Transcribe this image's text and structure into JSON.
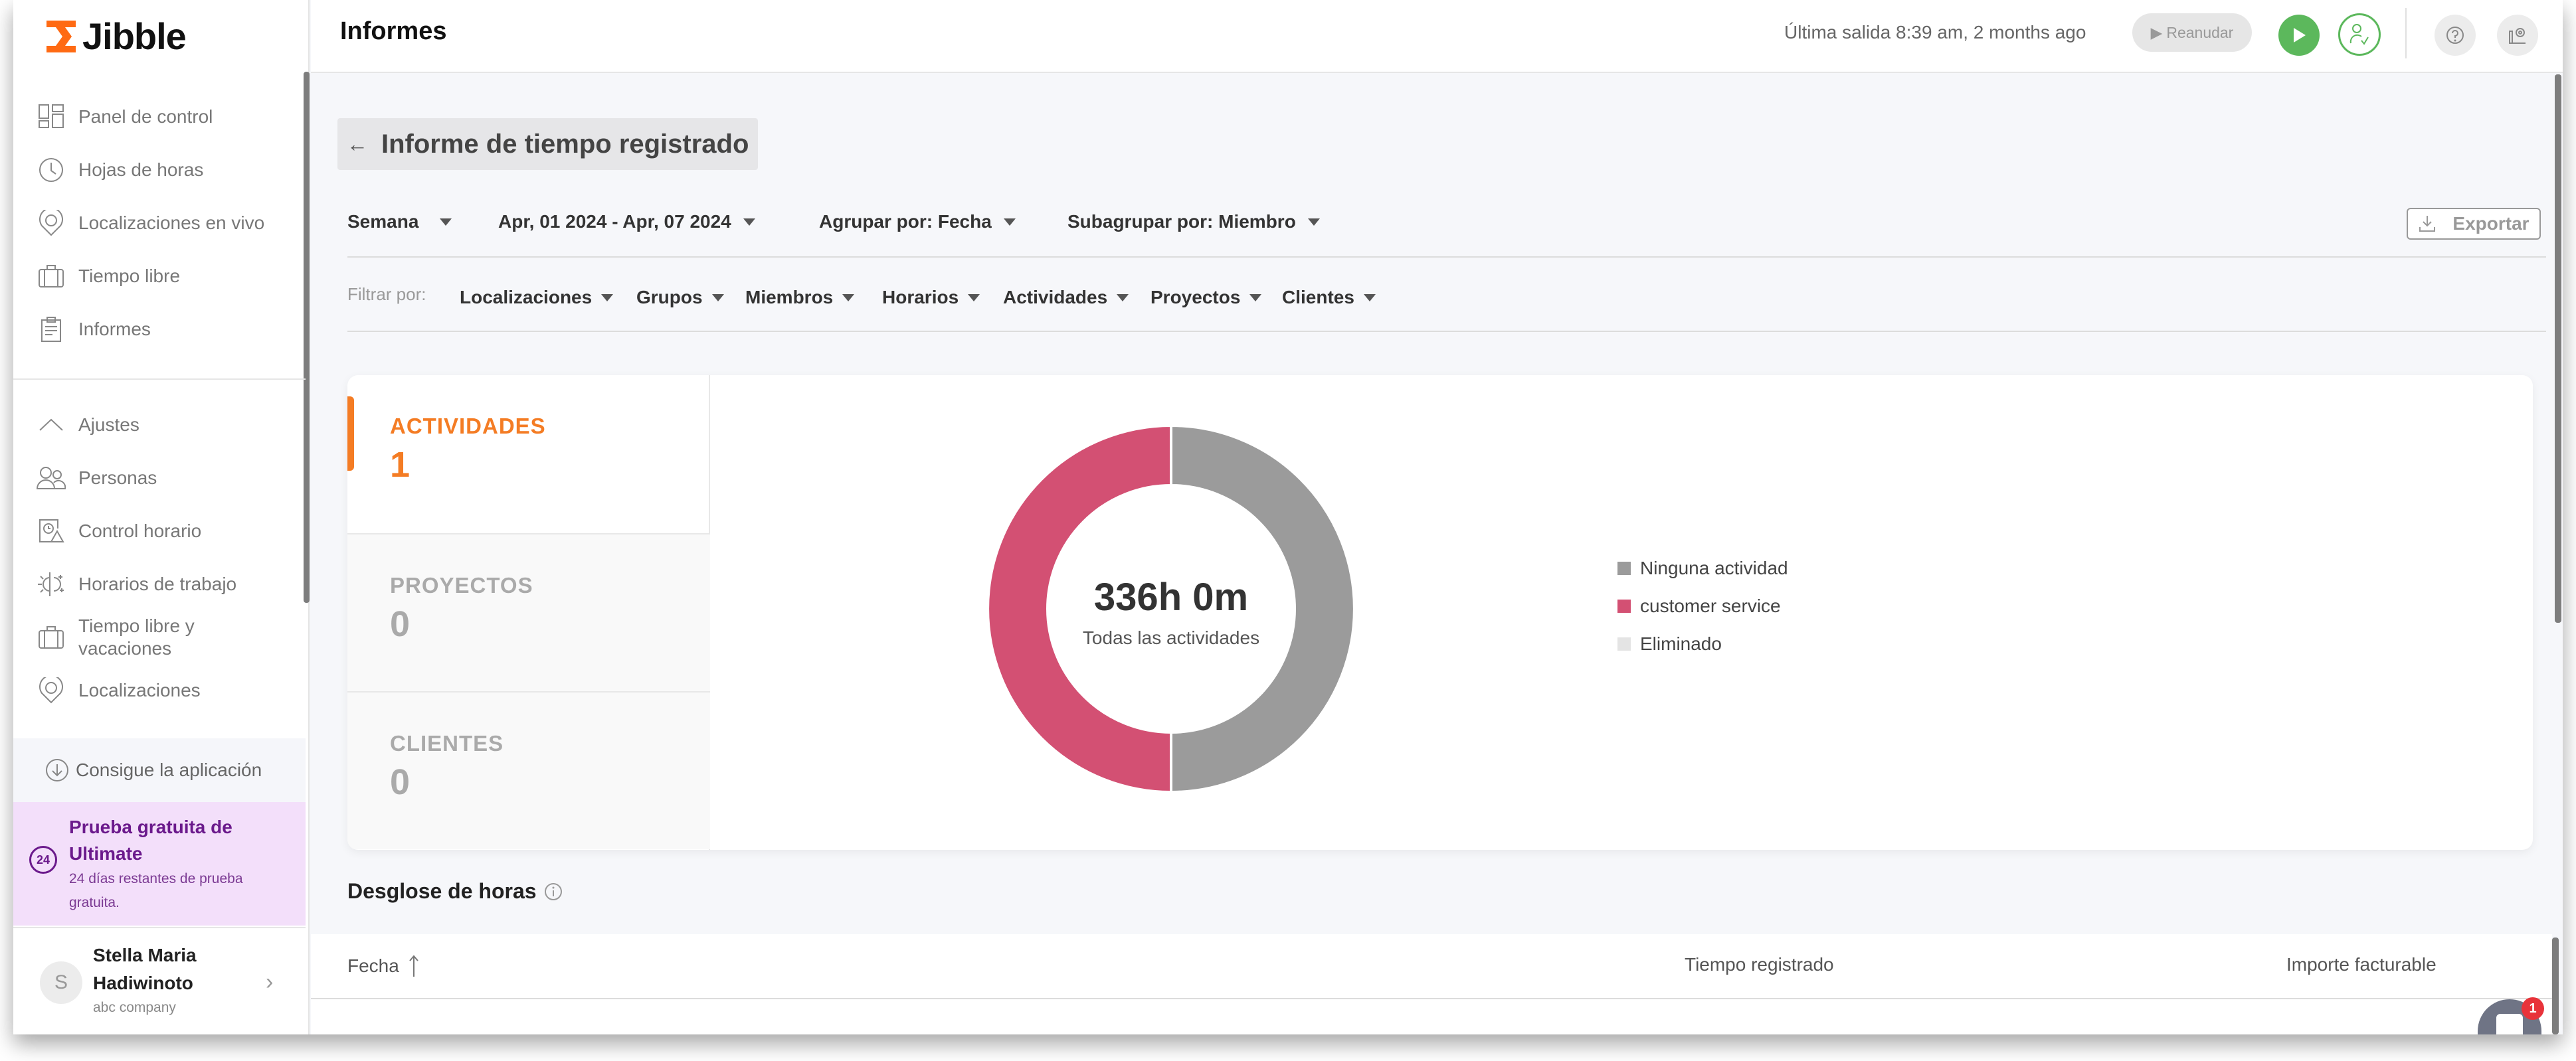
{
  "app": {
    "name": "Jibble",
    "brand_color": "#ff6a13"
  },
  "sidebar": {
    "primary_items": [
      {
        "label": "Panel de control",
        "icon": "dashboard-icon"
      },
      {
        "label": "Hojas de horas",
        "icon": "clock-icon"
      },
      {
        "label": "Localizaciones en vivo",
        "icon": "map-pin-icon"
      },
      {
        "label": "Tiempo libre",
        "icon": "suitcase-icon"
      },
      {
        "label": "Informes",
        "icon": "clipboard-icon"
      }
    ],
    "settings_items": [
      {
        "label": "Ajustes",
        "icon": "chevron-up-icon"
      },
      {
        "label": "Personas",
        "icon": "people-icon"
      },
      {
        "label": "Control horario",
        "icon": "time-tracking-icon"
      },
      {
        "label": "Horarios de trabajo",
        "icon": "day-night-icon"
      },
      {
        "label": "Tiempo libre y vacaciones",
        "icon": "suitcase-icon"
      },
      {
        "label": "Localizaciones",
        "icon": "map-pin-icon"
      }
    ],
    "get_app": "Consigue la aplicación",
    "trial": {
      "badge": "24",
      "title": "Prueba gratuita de Ultimate",
      "subtitle": "24 días restantes de prueba gratuita."
    },
    "user": {
      "initial": "S",
      "name": "Stella Maria Hadiwinoto",
      "company": "abc company"
    }
  },
  "header": {
    "title": "Informes",
    "last_out": "Última salida 8:39 am, 2 months ago",
    "resume_label": "Reanudar"
  },
  "report": {
    "title": "Informe de tiempo registrado",
    "controls": {
      "period": "Semana",
      "date_range": "Apr, 01 2024 - Apr, 07 2024",
      "group_by": "Agrupar por: Fecha",
      "subgroup_by": "Subagrupar por: Miembro",
      "export": "Exportar"
    },
    "filters": {
      "label": "Filtrar por:",
      "items": [
        "Localizaciones",
        "Grupos",
        "Miembros",
        "Horarios",
        "Actividades",
        "Proyectos",
        "Clientes"
      ]
    },
    "stats": [
      {
        "label": "ACTIVIDADES",
        "value": "1",
        "active": true
      },
      {
        "label": "PROYECTOS",
        "value": "0",
        "active": false
      },
      {
        "label": "CLIENTES",
        "value": "0",
        "active": false
      }
    ],
    "breakdown": {
      "title": "Desglose de horas",
      "columns": [
        "Fecha",
        "Tiempo registrado",
        "Importe facturable"
      ]
    }
  },
  "chat": {
    "badge": "1"
  },
  "chart_data": {
    "type": "pie",
    "donut": true,
    "center_value": "336h 0m",
    "center_label": "Todas las actividades",
    "total_hours": 336,
    "categories": [
      "Ninguna actividad",
      "customer service",
      "Eliminado"
    ],
    "values": [
      168,
      168,
      0
    ],
    "colors": [
      "#9b9b9b",
      "#d35073",
      "#e4e4e4"
    ],
    "legend_position": "right"
  }
}
